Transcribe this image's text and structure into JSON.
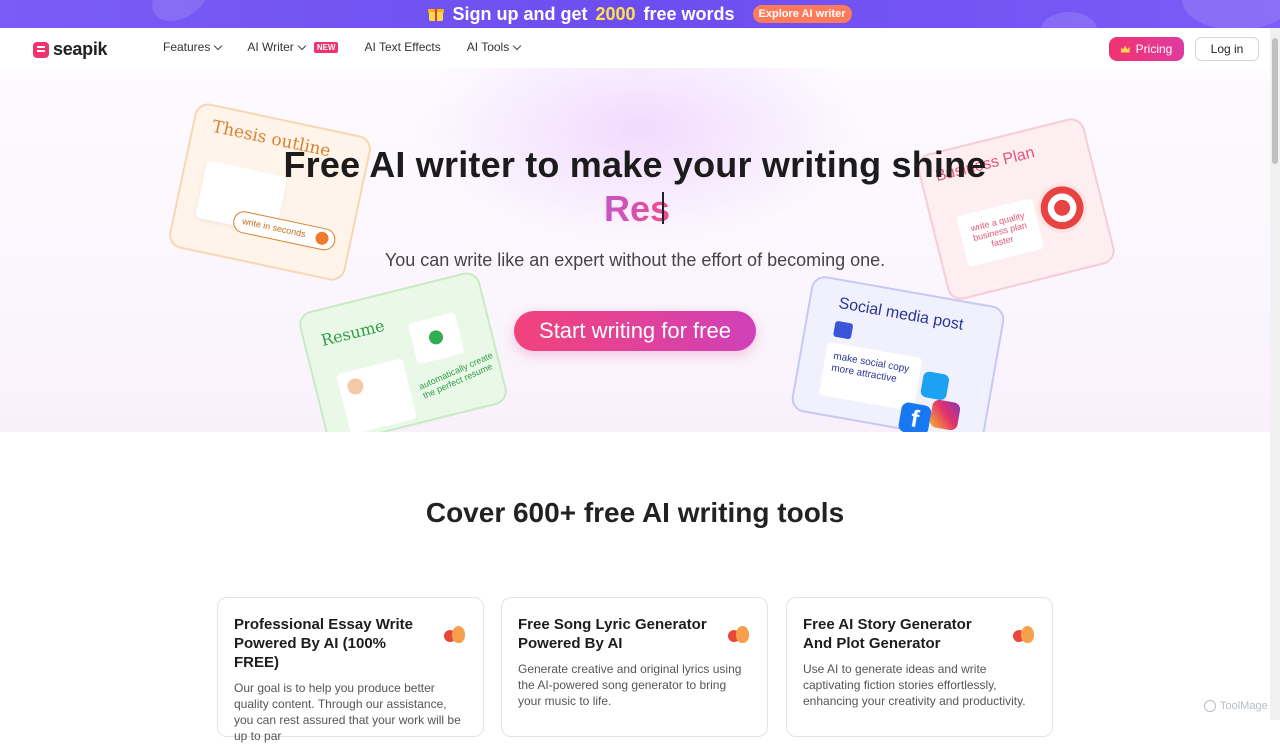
{
  "promo": {
    "text_pre": "Sign up and get",
    "highlight": "2000",
    "text_post": "free words",
    "button": "Explore AI writer",
    "background": "#6c4ef0"
  },
  "nav": {
    "logo": "seapik",
    "menu": [
      {
        "label": "Features",
        "dropdown": true
      },
      {
        "label": "AI Writer",
        "dropdown": true,
        "badge": "NEW"
      },
      {
        "label": "AI Text Effects",
        "dropdown": false
      },
      {
        "label": "AI Tools",
        "dropdown": true
      }
    ],
    "pricing": "Pricing",
    "login": "Log in"
  },
  "hero": {
    "title": "Free AI writer to make your writing shine",
    "typed": "Res",
    "subtitle": "You can write like an expert without the effort of becoming one.",
    "cta": "Start writing for free",
    "cards": {
      "thesis": {
        "title": "Thesis outline",
        "note": "write in seconds"
      },
      "resume": {
        "title": "Resume",
        "note": "automatically create the perfect resume"
      },
      "plan": {
        "title": "Business Plan",
        "note": "write a quality business plan faster"
      },
      "social": {
        "title": "Social media post",
        "note": "make social copy more attractive"
      }
    }
  },
  "tools": {
    "heading": "Cover 600+ free AI writing tools",
    "items": [
      {
        "title": "Professional Essay Write Powered By AI (100% FREE)",
        "desc": "Our goal is to help you produce better quality content. Through our assistance, you can rest assured that your work will be up to par"
      },
      {
        "title": "Free Song Lyric Generator Powered By AI",
        "desc": "Generate creative and original lyrics using the AI-powered song generator to bring your music to life."
      },
      {
        "title": "Free AI Story Generator And Plot Generator",
        "desc": "Use AI to generate ideas and write captivating fiction stories effortlessly, enhancing your creativity and productivity."
      }
    ]
  },
  "watermark": "ToolMage",
  "colors": {
    "accent": "#f0336e",
    "accent2": "#d041b8",
    "promo": "#6c4ef0"
  }
}
